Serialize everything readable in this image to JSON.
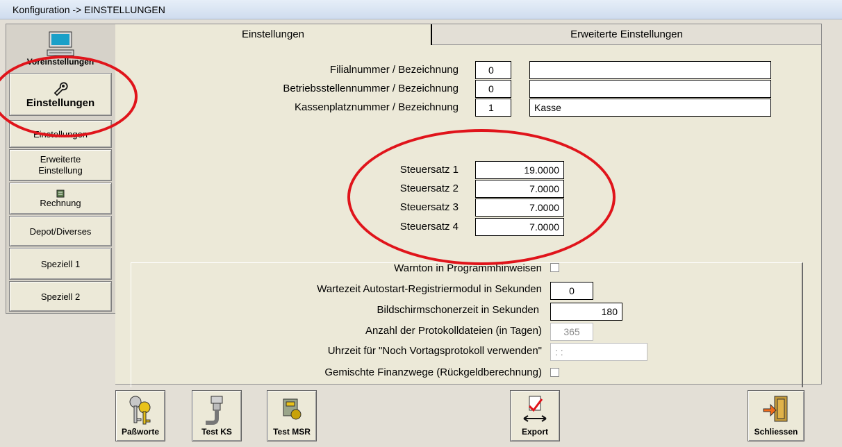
{
  "window": {
    "title": "Konfiguration -> EINSTELLUNGEN"
  },
  "sidebar": {
    "top_items": [
      {
        "label": "Voreinstellungen"
      },
      {
        "label": "Einstellungen"
      }
    ],
    "items": [
      {
        "label": "Einstellungen"
      },
      {
        "label": "Erweiterte Einstellung"
      },
      {
        "label": "Rechnung"
      },
      {
        "label": "Depot/Diverses"
      },
      {
        "label": "Speziell 1"
      },
      {
        "label": "Speziell 2"
      }
    ]
  },
  "tabs": [
    {
      "label": "Einstellungen"
    },
    {
      "label": "Erweiterte Einstellungen"
    }
  ],
  "ids": [
    {
      "label": "Filialnummer / Bezeichnung",
      "number": "0",
      "name": ""
    },
    {
      "label": "Betriebsstellennummer / Bezeichnung",
      "number": "0",
      "name": ""
    },
    {
      "label": "Kassenplatznummer / Bezeichnung",
      "number": "1",
      "name": "Kasse"
    }
  ],
  "tax": [
    {
      "label": "Steuersatz 1",
      "value": "19.0000"
    },
    {
      "label": "Steuersatz 2",
      "value": "7.0000"
    },
    {
      "label": "Steuersatz 3",
      "value": "7.0000"
    },
    {
      "label": "Steuersatz 4",
      "value": "7.0000"
    }
  ],
  "options": {
    "warnton_label": "Warnton in Programmhinweisen",
    "wartezeit_label": "Wartezeit Autostart-Registriermodul in Sekunden",
    "wartezeit_value": "0",
    "bildschirm_label": "Bildschirmschonerzeit in Sekunden",
    "bildschirm_value": "180",
    "protokoll_label": "Anzahl der Protokolldateien (in Tagen)",
    "protokoll_value": "365",
    "uhrzeit_label": "Uhrzeit für \"Noch Vortagsprotokoll verwenden\"",
    "uhrzeit_value": ": :",
    "finanzwege_label": "Gemischte Finanzwege (Rückgeldberechnung)"
  },
  "toolbar": {
    "passworte": "Paßworte",
    "test_ks": "Test KS",
    "test_msr": "Test MSR",
    "export": "Export",
    "schliessen": "Schliessen"
  },
  "colors": {
    "annotation": "#e0141b",
    "accent_yellow": "#e8c21a"
  }
}
